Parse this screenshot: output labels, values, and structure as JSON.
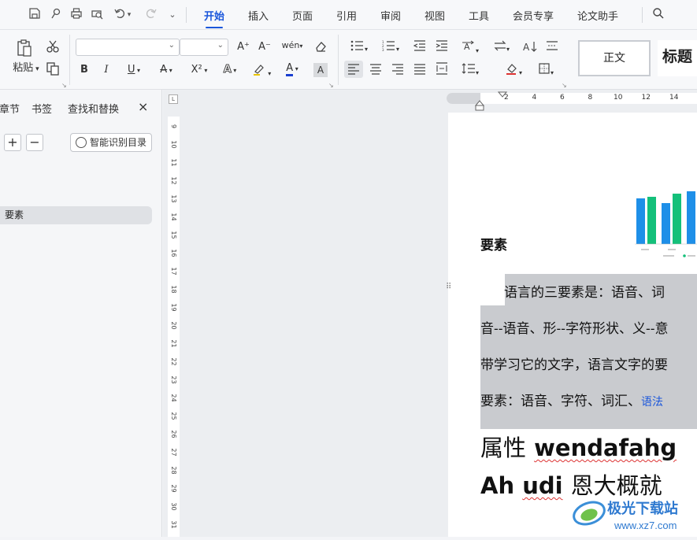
{
  "menubar": {
    "tabs": [
      "开始",
      "插入",
      "页面",
      "引用",
      "审阅",
      "视图",
      "工具",
      "会员专享",
      "论文助手"
    ],
    "active_tab": "开始",
    "quick_access_icons": [
      "save-icon",
      "format-painter-icon",
      "print-icon",
      "print-preview-icon",
      "undo-icon",
      "redo-icon",
      "more-icon"
    ],
    "search_icon": "search-icon"
  },
  "ribbon": {
    "paste_label": "粘贴",
    "font_name_value": "",
    "font_size_value": "",
    "bold": "B",
    "italic": "I",
    "underline": "U",
    "strikethrough": "A",
    "superscript": "X²",
    "text_effect": "A",
    "font_color": "A",
    "font_color_value": "#1a3fd0",
    "char_shading": "A",
    "grow_font": "A⁺",
    "shrink_font": "A⁻",
    "phonetic": "wén",
    "style_normal": "正文",
    "style_heading": "标题"
  },
  "navpane": {
    "tabs": [
      "章节",
      "书签",
      "查找和替换"
    ],
    "close_icon": "×",
    "expand_label": "+",
    "collapse_label": "−",
    "smart_toc_label": "智能识别目录",
    "toc_items": [
      "要素"
    ]
  },
  "vertical_ruler_numbers": [
    "9",
    "10",
    "11",
    "12",
    "13",
    "14",
    "15",
    "16",
    "17",
    "18",
    "19",
    "20",
    "21",
    "22",
    "23",
    "24",
    "25",
    "26",
    "27",
    "28",
    "29",
    "30",
    "31"
  ],
  "horizontal_ruler_numbers": [
    "2",
    "4",
    "6",
    "8",
    "10",
    "12",
    "14"
  ],
  "ruler_corner": "L",
  "document": {
    "heading": "要素",
    "lines": [
      "语言的三要素是：语音、词",
      "音--语音、形--字符形状、义--意",
      "带学习它的文字，语言文字的要",
      "要素：语音、字符、词汇、"
    ],
    "link_text": "语法",
    "big_line1_cn": "属性",
    "big_line1_en": "wendafahg",
    "big_line2_en1": "Ah",
    "big_line2_en2": "udi",
    "big_line2_cn": "恩大概就"
  },
  "watermark": {
    "site_name": "极光下载站",
    "url": "www.xz7.com"
  },
  "colors": {
    "accent": "#1a56db",
    "chart_blue": "#1e8fe8",
    "chart_green": "#14c07a",
    "selection": "#c9cbcf",
    "link": "#1a56db"
  }
}
